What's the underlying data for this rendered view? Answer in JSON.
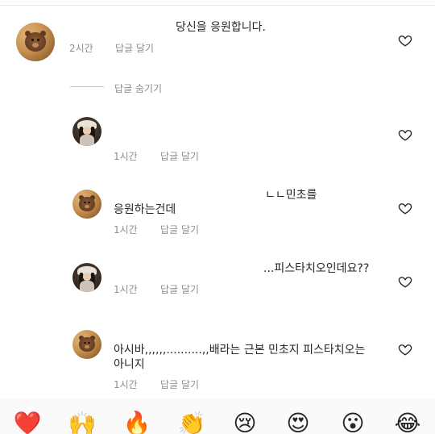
{
  "comment": {
    "text": "당신을 응원합니다.",
    "time": "2시간",
    "reply": "답글 달기"
  },
  "thread": {
    "hide_replies": "답글 숨기기"
  },
  "replies": [
    {
      "avatar": "hat-girl-avatar",
      "line1": "",
      "line2": "",
      "time": "1시간",
      "reply": "답글 달기"
    },
    {
      "avatar": "bear-avatar",
      "line1": "ㄴㄴ민초를",
      "line2": "응원하는건데",
      "time": "1시간",
      "reply": "답글 달기"
    },
    {
      "avatar": "hat-girl-avatar",
      "line1": "...피스타치오인데요??",
      "line2": "",
      "time": "1시간",
      "reply": "답글 달기"
    },
    {
      "avatar": "bear-avatar",
      "line1": "아시바,,,,,,..........,,배라는 근본 민초지 피스타치오는",
      "line2": "아니지",
      "time": "1시간",
      "reply": "답글 달기"
    }
  ],
  "reactions": [
    "❤️",
    "🙌",
    "🔥",
    "👏",
    "😢",
    "😍",
    "😮",
    "😂"
  ],
  "icons": {
    "like": "heart-outline-icon"
  },
  "colors": {
    "text": "#262626",
    "muted": "#8e8e8e",
    "icon": "#262626"
  }
}
